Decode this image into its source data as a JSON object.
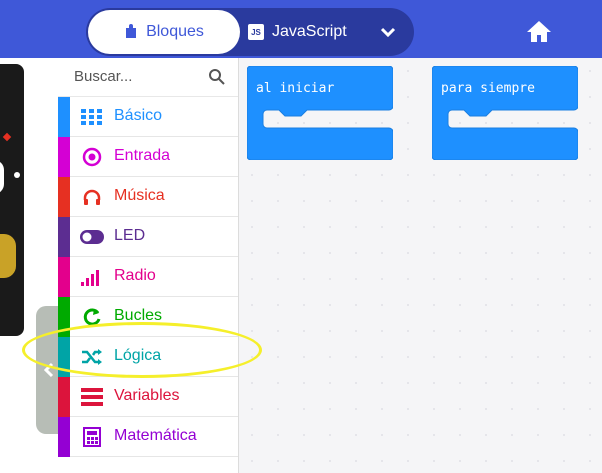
{
  "header": {
    "blocks_label": "Bloques",
    "javascript_label": "JavaScript",
    "js_badge": "JS"
  },
  "toolbox": {
    "search_placeholder": "Buscar...",
    "categories": [
      {
        "label": "Básico",
        "color": "#1e90ff",
        "icon": "grid-icon"
      },
      {
        "label": "Entrada",
        "color": "#d400d4",
        "icon": "target-icon"
      },
      {
        "label": "Música",
        "color": "#e63022",
        "icon": "headphones-icon"
      },
      {
        "label": "LED",
        "color": "#5c2d91",
        "icon": "toggle-icon"
      },
      {
        "label": "Radio",
        "color": "#e3008c",
        "icon": "signal-bars-icon"
      },
      {
        "label": "Bucles",
        "color": "#00aa00",
        "icon": "refresh-icon"
      },
      {
        "label": "Lógica",
        "color": "#00a4a6",
        "icon": "shuffle-icon"
      },
      {
        "label": "Variables",
        "color": "#dc143c",
        "icon": "list-icon"
      },
      {
        "label": "Matemática",
        "color": "#9400d3",
        "icon": "calculator-icon"
      }
    ]
  },
  "workspace": {
    "blocks": [
      {
        "label": "al iniciar",
        "color": "#1e90ff"
      },
      {
        "label": "para siempre",
        "color": "#1e90ff"
      }
    ]
  },
  "colors": {
    "header": "#3f58d8",
    "highlight": "#f5ef2b"
  }
}
